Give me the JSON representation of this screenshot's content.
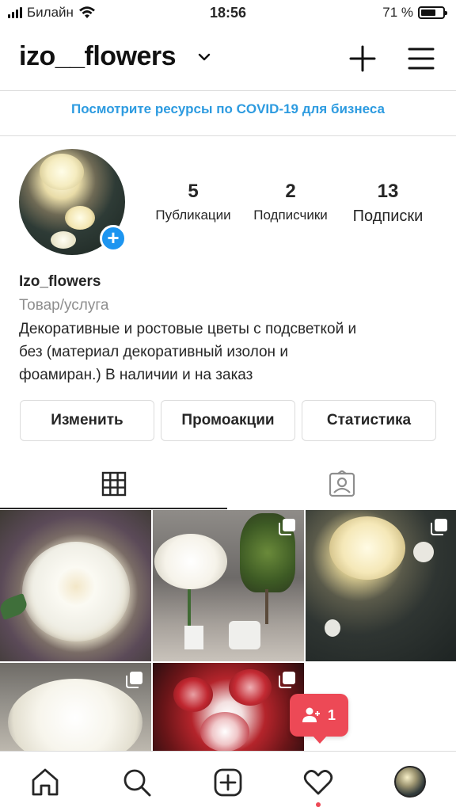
{
  "status_bar": {
    "carrier": "Билайн",
    "time": "18:56",
    "battery_percent": "71 %",
    "battery_level": 0.71
  },
  "header": {
    "username": "izo__flowers"
  },
  "covid_link": "Посмотрите ресурсы по COVID-19 для бизнеса",
  "profile": {
    "display_name": "Izo_flowers",
    "category": "Товар/услуга",
    "bio_lines": [
      "Декоративные и ростовые цветы с подсветкой и",
      "без (материал декоративный изолон и",
      "фоамиран.) В наличии и на заказ"
    ],
    "stats": [
      {
        "value": "5",
        "label": "Публикации"
      },
      {
        "value": "2",
        "label": "Подписчики"
      },
      {
        "value": "13",
        "label": "Подписки"
      }
    ]
  },
  "actions": {
    "edit": "Изменить",
    "promotions": "Промоакции",
    "insights": "Статистика"
  },
  "tabs": [
    {
      "icon": "grid-icon",
      "active": true
    },
    {
      "icon": "tagged-icon",
      "active": false
    }
  ],
  "notification": {
    "icon": "follower-icon",
    "count": "1"
  },
  "bottom_nav": [
    {
      "icon": "home-icon"
    },
    {
      "icon": "search-icon"
    },
    {
      "icon": "new-post-icon"
    },
    {
      "icon": "heart-icon"
    },
    {
      "icon": "profile-avatar"
    }
  ],
  "colors": {
    "link_blue": "#2d9be0",
    "accent_blue": "#1d95f0",
    "notification_red": "#ed4956"
  }
}
